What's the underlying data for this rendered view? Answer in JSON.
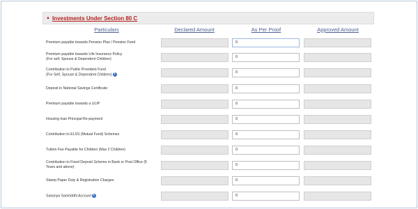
{
  "section": {
    "title": "Investments Under Section 80 C",
    "caret_icon": "caret-up-icon"
  },
  "columns": {
    "particulars": "Particulars",
    "declared": "Declared Amount",
    "as_per_proof": "As Per Proof",
    "approved": "Approved Amount"
  },
  "rows": [
    {
      "label_line1": "Premium payable towards Pension Plan / Pension Fund",
      "label_line2": "",
      "value": "0",
      "info": false
    },
    {
      "label_line1": "Premium payable towards Life Insurance Policy",
      "label_line2": "(For self, Spouse & Dependent Children)",
      "value": "0",
      "info": false
    },
    {
      "label_line1": "Contribution to Public Provident Fund",
      "label_line2": "(For Self, Spouse & Dependent Children)",
      "value": "0",
      "info": true
    },
    {
      "label_line1": "Deposit in National Savings Certificate",
      "label_line2": "",
      "value": "0",
      "info": false
    },
    {
      "label_line1": "Premium payable towards a ULIP",
      "label_line2": "",
      "value": "0",
      "info": false
    },
    {
      "label_line1": "Housing loan Principal Re-payment",
      "label_line2": "",
      "value": "0",
      "info": false
    },
    {
      "label_line1": "Contribution to ELSS (Mutual Fund) Schemes",
      "label_line2": "",
      "value": "0",
      "info": false
    },
    {
      "label_line1": "Tuition Fee Payable for Children (Max 2 Children)",
      "label_line2": "",
      "value": "0",
      "info": false
    },
    {
      "label_line1": "Contribution to Fixed Deposit Scheme in Bank or Post Office (5",
      "label_line2": "Years and above)",
      "value": "0",
      "info": false
    },
    {
      "label_line1": "Stamp Paper Duty & Registration Charges",
      "label_line2": "",
      "value": "0",
      "info": false
    },
    {
      "label_line1": "Sukanya Samriddhi Account",
      "label_line2": "",
      "value": "0",
      "info": true
    }
  ]
}
